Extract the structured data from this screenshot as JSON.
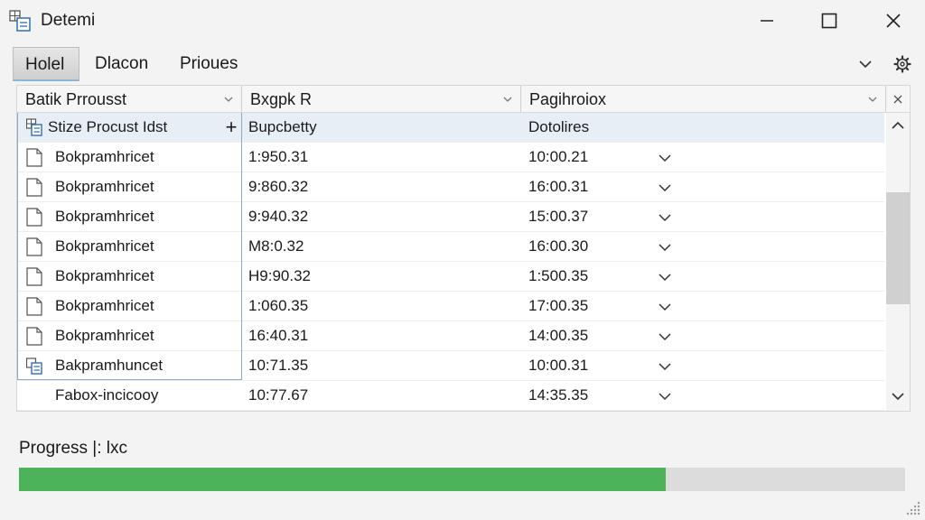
{
  "window": {
    "title": "Detemi",
    "app_icon": "table-window-icon",
    "controls": [
      "minimize-icon",
      "maximize-icon",
      "close-icon"
    ]
  },
  "tabs": [
    {
      "label": "Holel",
      "active": true
    },
    {
      "label": "Dlacon",
      "active": false
    },
    {
      "label": "Prioues",
      "active": false
    }
  ],
  "tab_tools": [
    "chevron-down-icon",
    "settings-icon"
  ],
  "grid": {
    "columns": [
      {
        "label": "Batik Prrousst"
      },
      {
        "label": "Bxgpk R"
      },
      {
        "label": "Pagihroiox"
      }
    ],
    "group_row": {
      "label": "Stize Procust Idst",
      "col2": "Bupcbetty",
      "col3": "Dotolires"
    },
    "rows": [
      {
        "name": "Bokpramhricet",
        "value": "1:950.31",
        "time": "10:00.21"
      },
      {
        "name": "Bokpramhricet",
        "value": "9:860.32",
        "time": "16:00.31"
      },
      {
        "name": "Bokpramhricet",
        "value": "9:940.32",
        "time": "15:00.37"
      },
      {
        "name": "Bokpramhricet",
        "value": "M8:0.32",
        "time": "16:00.30"
      },
      {
        "name": "Bokpramhricet",
        "value": "H9:90.32",
        "time": "1:500.35"
      },
      {
        "name": "Bokpramhricet",
        "value": "1:060.35",
        "time": "17:00.35"
      },
      {
        "name": "Bokpramhricet",
        "value": "16:40.31",
        "time": "14:00.35"
      },
      {
        "name": "Bakpramhuncet",
        "value": "10:71.35",
        "time": "10:00.31"
      },
      {
        "name": "Fabox-incicooy",
        "value": "10:77.67",
        "time": "14:35.35"
      }
    ]
  },
  "progress": {
    "label": "Progress |: lxc",
    "value": 0.73,
    "color": "#4cb35a"
  },
  "colors": {
    "accent": "#8cb6d8",
    "group_row": "#e8eef5"
  }
}
